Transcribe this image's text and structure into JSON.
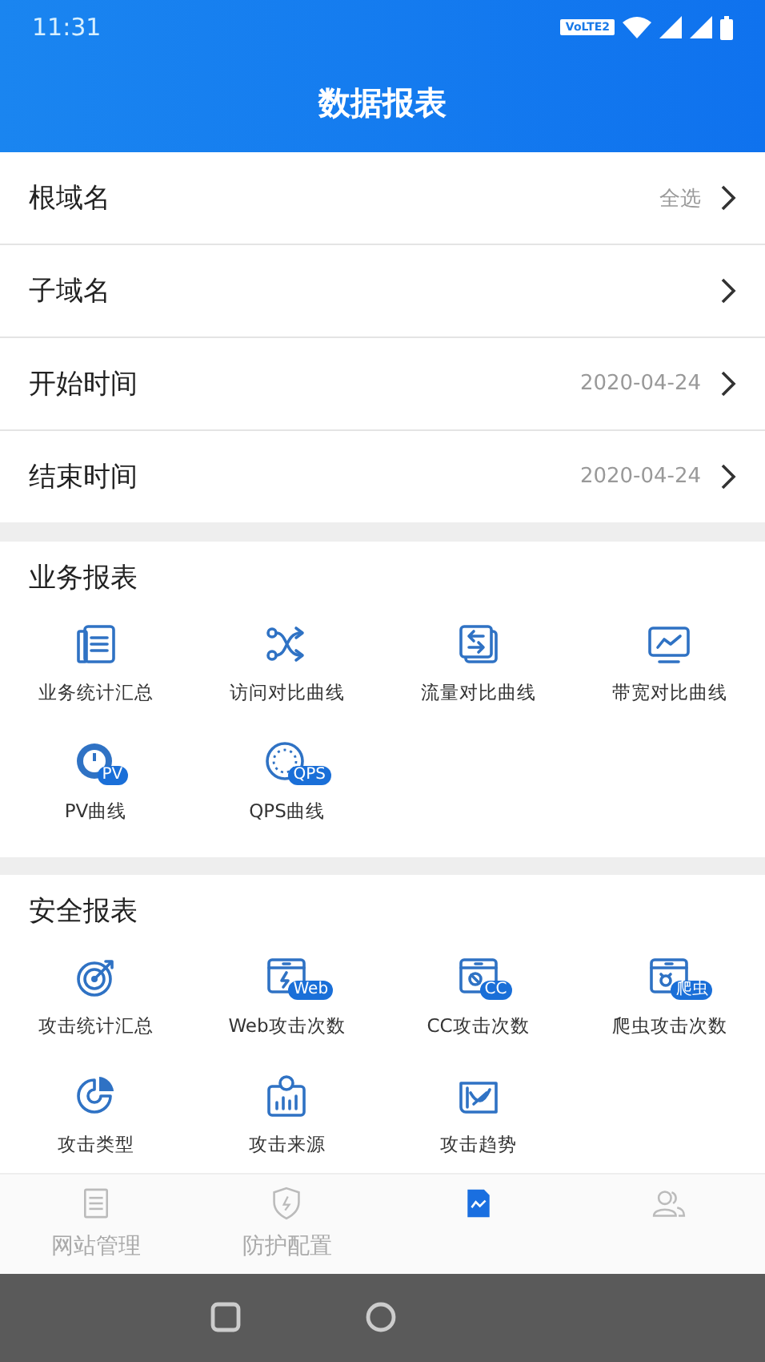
{
  "status_bar": {
    "time": "11:31",
    "network_badge": "VoLTE2"
  },
  "header": {
    "title": "数据报表"
  },
  "filters": [
    {
      "label": "根域名",
      "value": "全选"
    },
    {
      "label": "子域名"
    },
    {
      "label": "开始时间",
      "value": "2020-04-24"
    },
    {
      "label": "结束时间",
      "value": "2020-04-24"
    }
  ],
  "sections": [
    {
      "title": "业务报表",
      "items": [
        {
          "label": "业务统计汇总"
        },
        {
          "label": "访问对比曲线"
        },
        {
          "label": "流量对比曲线"
        },
        {
          "label": "带宽对比曲线"
        },
        {
          "label": "PV曲线",
          "badge": "PV"
        },
        {
          "label": "QPS曲线",
          "badge": "QPS"
        }
      ]
    },
    {
      "title": "安全报表",
      "items": [
        {
          "label": "攻击统计汇总"
        },
        {
          "label": "Web攻击次数",
          "badge": "Web"
        },
        {
          "label": "CC攻击次数",
          "badge": "CC"
        },
        {
          "label": "爬虫攻击次数",
          "badge": "爬虫"
        },
        {
          "label": "攻击类型"
        },
        {
          "label": "攻击来源"
        },
        {
          "label": "攻击趋势"
        }
      ]
    }
  ],
  "tabs": [
    {
      "label": "网站管理",
      "selected": false
    },
    {
      "label": "防护配置",
      "selected": false
    },
    {
      "selected": true
    },
    {
      "selected": false
    }
  ]
}
